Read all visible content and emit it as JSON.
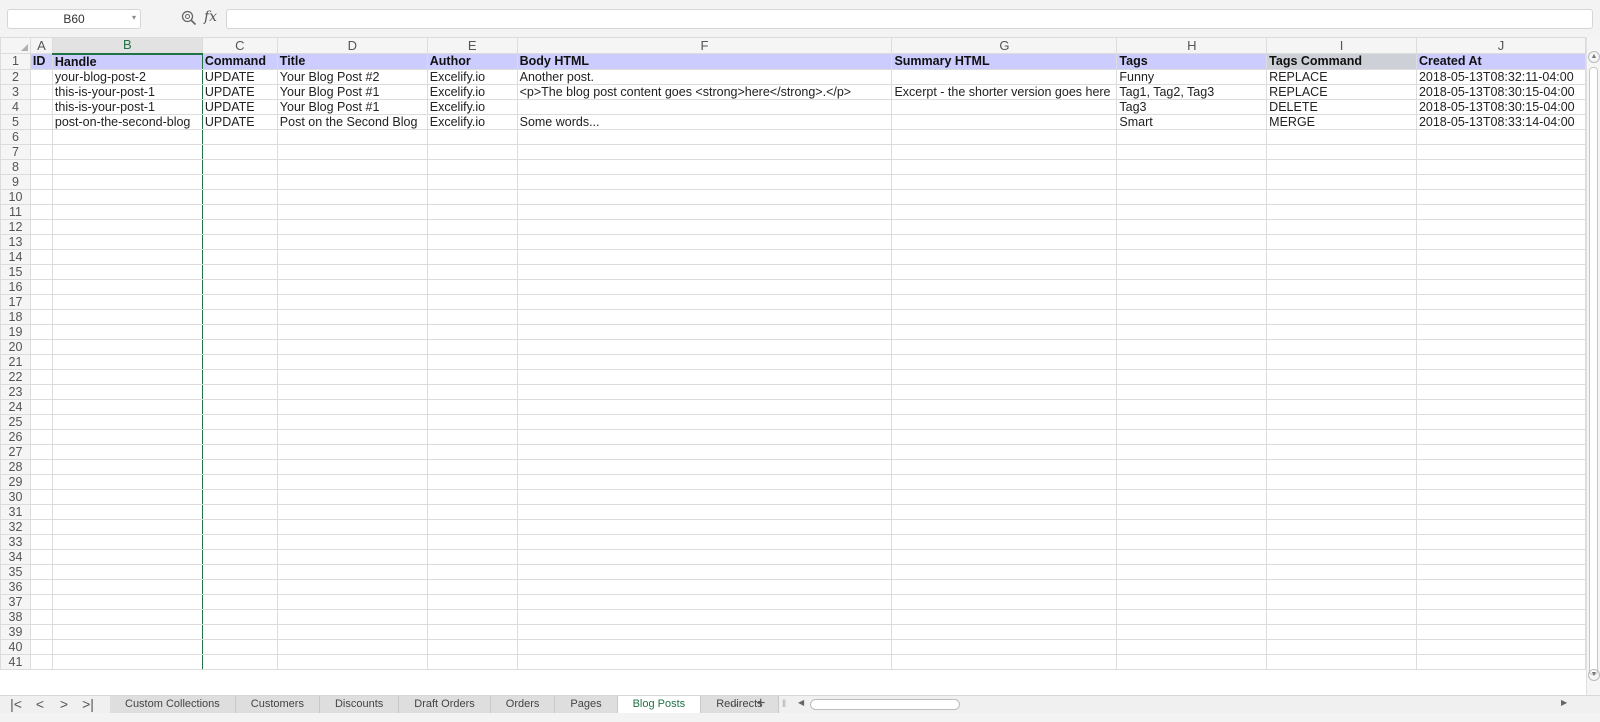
{
  "formula_bar": {
    "name_box": "B60",
    "fx_label": "fx",
    "formula": ""
  },
  "columns": [
    "",
    "A",
    "B",
    "C",
    "D",
    "E",
    "F",
    "G",
    "H",
    "I",
    "J"
  ],
  "header_row": {
    "row_number": "1",
    "cells": [
      "ID",
      "Handle",
      "Command",
      "Title",
      "Author",
      "Body HTML",
      "Summary HTML",
      "Tags",
      "Tags Command",
      "Created At"
    ]
  },
  "rows": [
    {
      "n": "2",
      "cells": [
        "",
        "your-blog-post-2",
        "UPDATE",
        "Your Blog Post #2",
        "Excelify.io",
        "Another post.",
        "",
        "Funny",
        "REPLACE",
        "2018-05-13T08:32:11-04:00"
      ]
    },
    {
      "n": "3",
      "cells": [
        "",
        "this-is-your-post-1",
        "UPDATE",
        "Your Blog Post #1",
        "Excelify.io",
        "<p>The blog post content goes <strong>here</strong>.</p>",
        "Excerpt - the shorter version goes here",
        "Tag1, Tag2, Tag3",
        "REPLACE",
        "2018-05-13T08:30:15-04:00"
      ]
    },
    {
      "n": "4",
      "cells": [
        "",
        "this-is-your-post-1",
        "UPDATE",
        "Your Blog Post #1",
        "Excelify.io",
        "",
        "",
        "Tag3",
        "DELETE",
        "2018-05-13T08:30:15-04:00"
      ]
    },
    {
      "n": "5",
      "cells": [
        "",
        "post-on-the-second-blog",
        "UPDATE",
        "Post on the Second Blog",
        "Excelify.io",
        "Some words...",
        "",
        "Smart",
        "MERGE",
        "2018-05-13T08:33:14-04:00"
      ]
    }
  ],
  "empty_row_numbers": [
    "6",
    "7",
    "8",
    "9",
    "10",
    "11",
    "12",
    "13",
    "14",
    "15",
    "16",
    "17",
    "18",
    "19",
    "20",
    "21",
    "22",
    "23",
    "24",
    "25",
    "26",
    "27",
    "28",
    "29",
    "30",
    "31",
    "32",
    "33",
    "34",
    "35",
    "36",
    "37",
    "38",
    "39",
    "40",
    "41"
  ],
  "sheet_tabs": [
    "Custom Collections",
    "Customers",
    "Discounts",
    "Draft Orders",
    "Orders",
    "Pages",
    "Blog Posts",
    "Redirects"
  ],
  "active_tab": "Blog Posts",
  "sheet_nav": {
    "first": "|<",
    "prev": "<",
    "next": ">",
    "last": ">|",
    "more": "···",
    "add": "+"
  },
  "colors": {
    "header_fill": "#ccccff",
    "selection": "#217346"
  }
}
